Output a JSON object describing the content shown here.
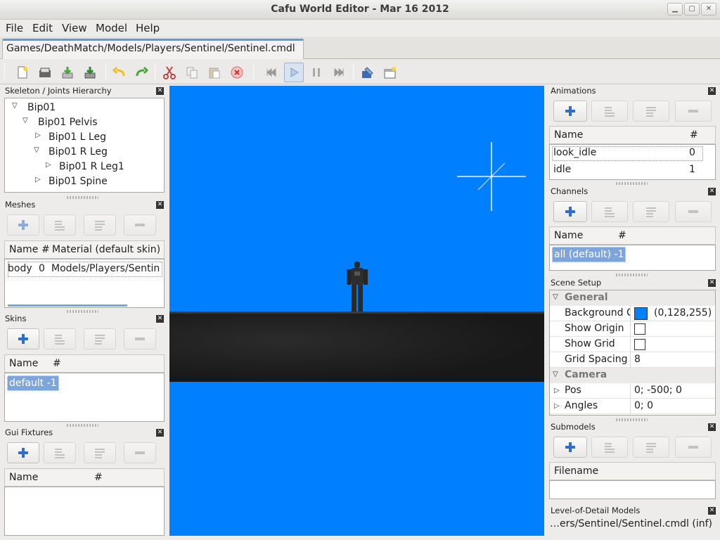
{
  "window": {
    "title": "Cafu World Editor - Mar 16 2012"
  },
  "menu": [
    "File",
    "Edit",
    "View",
    "Model",
    "Help"
  ],
  "doc_tab": "Games/DeathMatch/Models/Players/Sentinel/Sentinel.cmdl",
  "toolbar": [
    "new-file-icon",
    "open-icon",
    "save-icon",
    "save-as-icon",
    "undo-icon",
    "redo-icon",
    "cut-icon",
    "copy-icon",
    "paste-icon",
    "delete-icon",
    "first-frame-icon",
    "play-icon",
    "pause-icon",
    "last-frame-icon",
    "properties-icon",
    "new-window-icon"
  ],
  "skeleton": {
    "title": "Skeleton / Joints Hierarchy",
    "nodes": [
      "Bip01",
      "Bip01 Pelvis",
      "Bip01 L Leg",
      "Bip01 R Leg",
      "Bip01 R Leg1",
      "Bip01 Spine"
    ]
  },
  "meshes": {
    "title": "Meshes",
    "cols": [
      "Name",
      "#",
      "Material (default skin)"
    ],
    "row": {
      "name": "body",
      "num": "0",
      "material": "Models/Players/Sentin"
    }
  },
  "skins": {
    "title": "Skins",
    "cols": [
      "Name",
      "#"
    ],
    "row": "default  -1"
  },
  "gui": {
    "title": "Gui Fixtures",
    "cols": [
      "Name",
      "#"
    ]
  },
  "animations": {
    "title": "Animations",
    "cols": [
      "Name",
      "#"
    ],
    "rows": [
      {
        "name": "look_idle",
        "num": "0"
      },
      {
        "name": "idle",
        "num": "1"
      }
    ]
  },
  "channels": {
    "title": "Channels",
    "cols": [
      "Name",
      "#"
    ],
    "row": "all (default)  -1"
  },
  "scene": {
    "title": "Scene Setup",
    "general": "General",
    "background_label": "Background C",
    "background_value": "(0,128,255)",
    "background_color": "#0080ff",
    "show_origin": "Show Origin",
    "show_grid": "Show Grid",
    "grid_spacing_label": "Grid Spacing",
    "grid_spacing": "8",
    "camera": "Camera",
    "pos_label": "Pos",
    "pos": "0; -500; 0",
    "angles_label": "Angles",
    "angles": "0; 0"
  },
  "submodels": {
    "title": "Submodels",
    "col": "Filename"
  },
  "lod": {
    "title": "Level-of-Detail Models",
    "value": "…ers/Sentinel/Sentinel.cmdl (inf)"
  },
  "colors": {
    "viewport": "#0080ff",
    "accent": "#2f6fc9"
  }
}
